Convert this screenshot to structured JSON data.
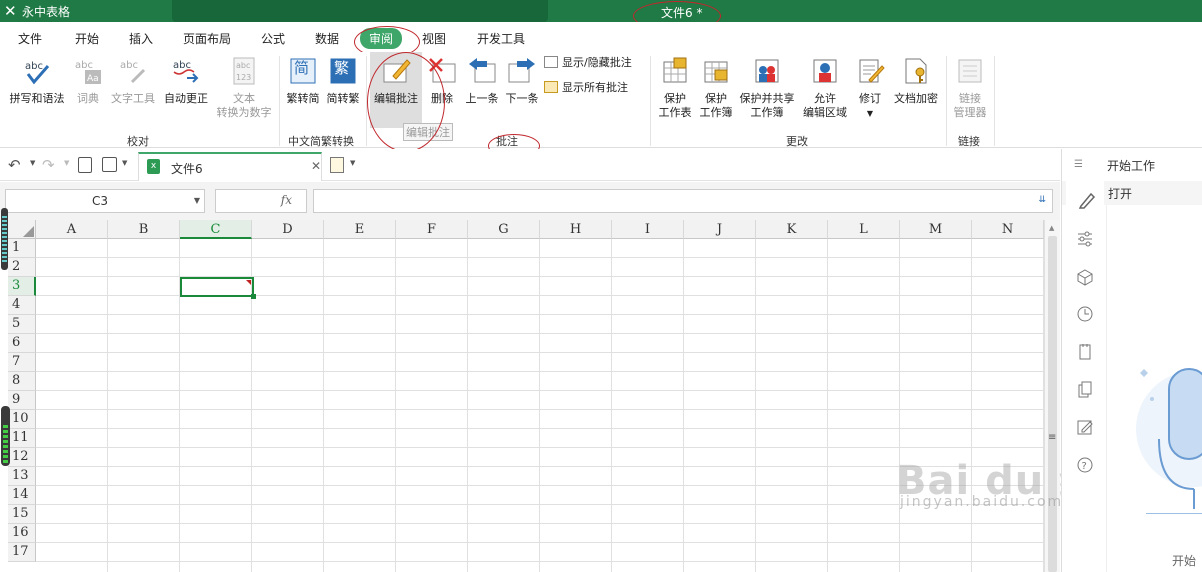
{
  "window": {
    "app_name": "永中表格",
    "doc_title": "文件6 *"
  },
  "menu": {
    "tabs": [
      "文件",
      "开始",
      "插入",
      "页面布局",
      "公式",
      "数据",
      "审阅",
      "视图",
      "开发工具"
    ],
    "active": "审阅"
  },
  "ribbon": {
    "proofing": {
      "spell": "拼写和语法",
      "dict": "词典",
      "text_tools": "文字工具",
      "autocorrect": "自动更正",
      "convert_line1": "文本",
      "convert_line2": "转换为数字",
      "group": "校对"
    },
    "chinese": {
      "t2s": "繁转简",
      "s2t": "简转繁",
      "t2s_glyph": "简",
      "s2t_glyph": "繁",
      "group": "中文简繁转换"
    },
    "comments": {
      "edit": "编辑批注",
      "delete": "删除",
      "prev": "上一条",
      "next": "下一条",
      "show_hide": "显示/隐藏批注",
      "show_all": "显示所有批注",
      "tooltip": "编辑批注",
      "group": "批注"
    },
    "changes": {
      "protect_sheet_1": "保护",
      "protect_sheet_2": "工作表",
      "protect_book_1": "保护",
      "protect_book_2": "工作簿",
      "share_1": "保护并共享",
      "share_2": "工作簿",
      "allow_1": "允许",
      "allow_2": "编辑区域",
      "revise": "修订",
      "encrypt": "文档加密",
      "group": "更改"
    },
    "links": {
      "manager_1": "链接",
      "manager_2": "管理器",
      "group": "链接"
    }
  },
  "tabs": {
    "doc_tab": "文件6"
  },
  "formula_bar": {
    "name_box": "C3",
    "fx": "fx",
    "value": ""
  },
  "grid": {
    "columns": [
      "A",
      "B",
      "C",
      "D",
      "E",
      "F",
      "G",
      "H",
      "I",
      "J",
      "K",
      "L",
      "M",
      "N"
    ],
    "rows": [
      "1",
      "2",
      "3",
      "4",
      "5",
      "6",
      "7",
      "8",
      "9",
      "10",
      "11",
      "12",
      "13",
      "14",
      "15",
      "16",
      "17"
    ],
    "active_cell": "C3"
  },
  "right_panel": {
    "title": "开始工作",
    "open": "打开",
    "bottom_text": "开始"
  },
  "watermark": {
    "text": "Bai du 经验",
    "sub": "jingyan.baidu.com"
  },
  "colors": {
    "title_green": "#1f7a45",
    "active_tab": "#3fa66a",
    "annotation_red": "#c0282d",
    "selection_green": "#1a8a3a"
  }
}
